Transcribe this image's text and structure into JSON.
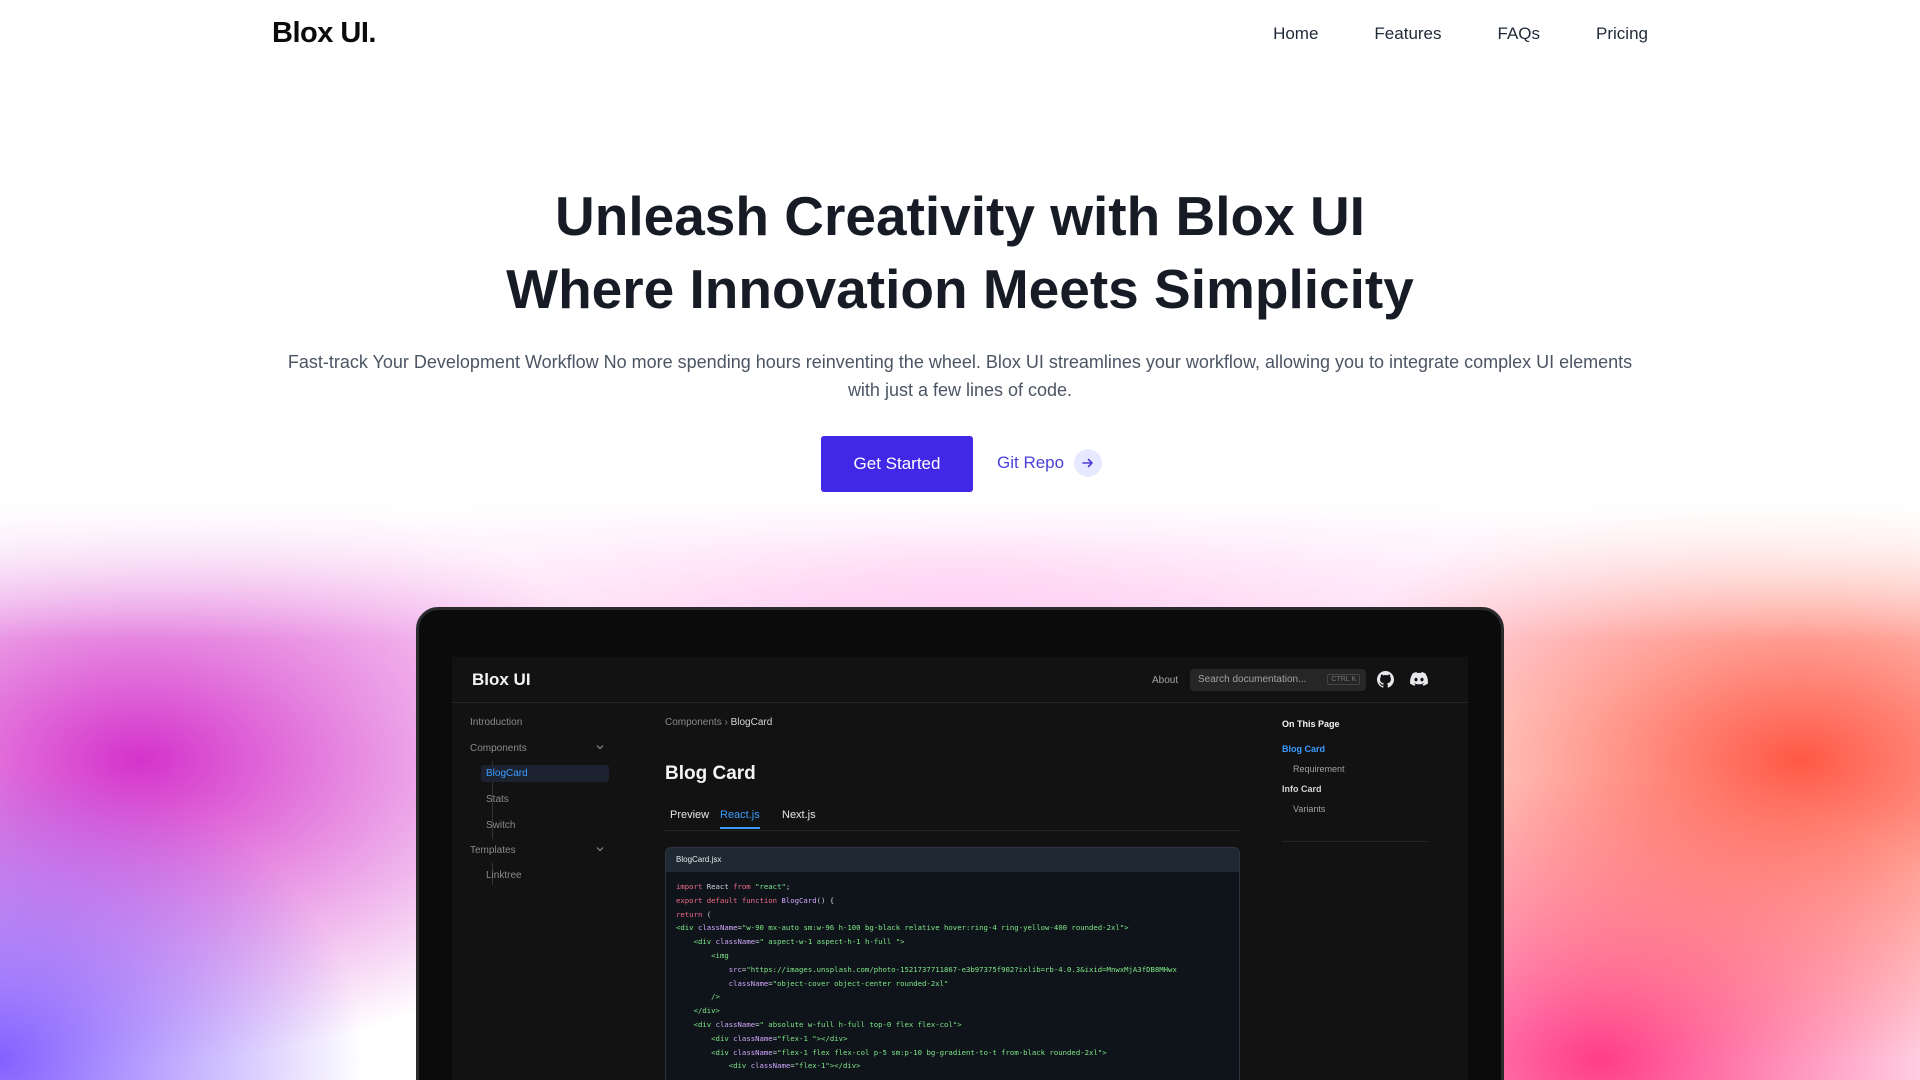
{
  "nav": {
    "logo": "Blox UI.",
    "links": [
      "Home",
      "Features",
      "FAQs",
      "Pricing"
    ]
  },
  "hero": {
    "title_line1": "Unleash Creativity with Blox UI",
    "title_line2": "Where Innovation Meets Simplicity",
    "subtitle": "Fast-track Your Development Workflow No more spending hours reinventing the wheel. Blox UI streamlines your workflow, allowing you to integrate complex UI elements with just a few lines of code.",
    "primary_button": "Get Started",
    "secondary_button": "Git Repo"
  },
  "preview": {
    "app_title": "Blox UI",
    "about": "About",
    "search_placeholder": "Search documentation...",
    "search_shortcut": "CTRL K",
    "sidebar": {
      "introduction": "Introduction",
      "components": "Components",
      "component_items": [
        "BlogCard",
        "Stats",
        "Switch"
      ],
      "templates": "Templates",
      "template_items": [
        "Linktree"
      ]
    },
    "breadcrumb": [
      "Components",
      "BlogCard"
    ],
    "doc_title": "Blog Card",
    "tabs": [
      "Preview",
      "React.js",
      "Next.js"
    ],
    "active_tab": "React.js",
    "code_filename": "BlogCard.jsx",
    "toc": {
      "title": "On This Page",
      "items": [
        "Blog Card",
        "Requirement",
        "Info Card",
        "Variants"
      ]
    }
  },
  "colors": {
    "primary_button": "#4127e6",
    "link": "#4b3fd9",
    "preview_accent": "#3b9cff"
  }
}
